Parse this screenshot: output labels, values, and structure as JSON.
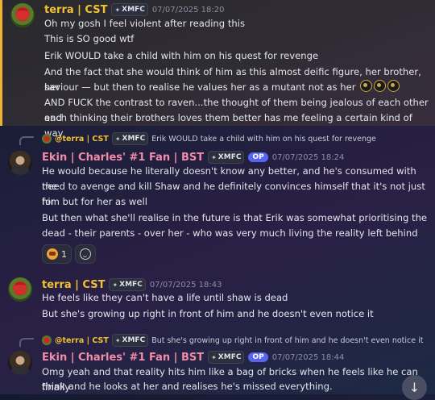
{
  "messages": {
    "m1": {
      "author": "terra | CST",
      "tag": "XMFC",
      "timestamp": "07/07/2025 18:20",
      "lines": [
        "Oh my gosh I feel violent after reading this",
        "This is SO good wtf",
        "Erik WOULD take a child with him on his quest for revenge",
        "And the fact that she would think of him as this almost deific figure, her brother, her",
        "saviour — but then to realise he values her as a mutant not as her",
        "AND FUCK the contrast to raven...the thought of them being jealous of each other and",
        "each thinking their brothers loves them better has me feeling a certain kind of way"
      ]
    },
    "m2": {
      "reply": {
        "author": "@terra | CST",
        "tag": "XMFC",
        "text": "Erik WOULD take a child with him on his quest for revenge"
      },
      "author": "Ekin | Charles' #1 Fan | BST",
      "tag": "XMFC",
      "badge": "OP",
      "timestamp": "07/07/2025 18:24",
      "lines": [
        "He would because he literally doesn't know any better, and he's consumed with the",
        "need to avenge and kill Shaw and he definitely convinces himself that it's not just for",
        "him but for her as well",
        "But then what she'll realise in the future is that Erik was somewhat prioritising the",
        "dead - their parents - over her - who was very much living the reality left behind"
      ],
      "reaction_count": "1"
    },
    "m3": {
      "author": "terra | CST",
      "tag": "XMFC",
      "timestamp": "07/07/2025 18:43",
      "lines": [
        "He feels like they can't have a life until shaw is dead",
        "But she's growing up right in front of him and he doesn't even notice it"
      ]
    },
    "m4": {
      "reply": {
        "author": "@terra | CST",
        "tag": "XMFC",
        "text": "But she's growing up right in front of him and he doesn't even notice it"
      },
      "author": "Ekin | Charles' #1 Fan | BST",
      "tag": "XMFC",
      "badge": "OP",
      "timestamp": "07/07/2025 18:44",
      "lines": [
        "Omg yeah and that reality hits him like a bag of bricks when he feels like he can finally",
        "think and he looks at her and realises he's missed everything."
      ]
    }
  },
  "scroll_icon": "↓"
}
